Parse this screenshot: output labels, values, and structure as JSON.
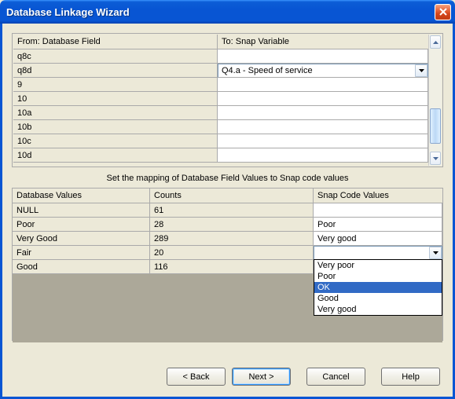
{
  "window": {
    "title": "Database Linkage Wizard"
  },
  "top_table": {
    "headers": {
      "from": "From: Database Field",
      "to": "To: Snap Variable"
    },
    "rows": [
      {
        "from": "q8c",
        "to": ""
      },
      {
        "from": "q8d",
        "to": "Q4.a - Speed of service"
      },
      {
        "from": "9",
        "to": ""
      },
      {
        "from": "10",
        "to": ""
      },
      {
        "from": "10a",
        "to": ""
      },
      {
        "from": "10b",
        "to": ""
      },
      {
        "from": "10c",
        "to": ""
      },
      {
        "from": "10d",
        "to": ""
      }
    ],
    "combo_row_index": 1
  },
  "caption": "Set the mapping of Database Field Values to Snap code values",
  "map_table": {
    "headers": {
      "db": "Database Values",
      "counts": "Counts",
      "snap": "Snap Code Values"
    },
    "rows": [
      {
        "db": "NULL",
        "counts": "61",
        "snap": ""
      },
      {
        "db": "Poor",
        "counts": "28",
        "snap": "Poor"
      },
      {
        "db": "Very Good",
        "counts": "289",
        "snap": "Very good"
      },
      {
        "db": "Fair",
        "counts": "20",
        "snap": ""
      },
      {
        "db": "Good",
        "counts": "116",
        "snap": ""
      }
    ],
    "combo_row_index": 3,
    "dropdown": {
      "options": [
        "Very poor",
        "Poor",
        "OK",
        "Good",
        "Very good"
      ],
      "selected_index": 2
    }
  },
  "buttons": {
    "back": "< Back",
    "next": "Next >",
    "cancel": "Cancel",
    "help": "Help"
  }
}
